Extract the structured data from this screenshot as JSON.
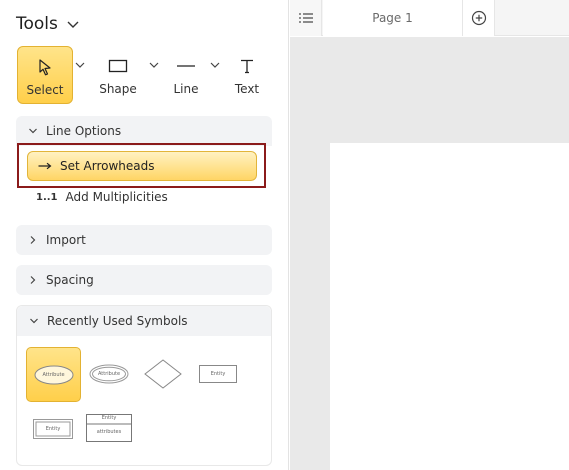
{
  "tools": {
    "title": "Tools",
    "items": [
      {
        "label": "Select",
        "icon": "cursor-icon",
        "active": true
      },
      {
        "label": "Shape",
        "icon": "rectangle-icon"
      },
      {
        "label": "Line",
        "icon": "line-icon"
      },
      {
        "label": "Text",
        "icon": "text-icon"
      }
    ]
  },
  "sections": {
    "line_options": {
      "title": "Line Options",
      "set_arrowheads": "Set Arrowheads",
      "add_multiplicities": "Add Multiplicities",
      "multiplicities_icon": "1..1"
    },
    "import": {
      "title": "Import"
    },
    "spacing": {
      "title": "Spacing"
    },
    "recent": {
      "title": "Recently Used Symbols",
      "symbols": [
        {
          "name": "attribute",
          "label": "Attribute"
        },
        {
          "name": "derived-attribute",
          "label": "Attribute"
        },
        {
          "name": "relationship",
          "label": ""
        },
        {
          "name": "entity",
          "label": "Entity"
        },
        {
          "name": "weak-entity",
          "label": "Entity"
        },
        {
          "name": "entity-with-attributes",
          "label": "Entity",
          "sublabel": "attributes"
        }
      ]
    }
  },
  "tabs": {
    "page_label": "Page 1"
  },
  "colors": {
    "accent": "#ffcf4a",
    "highlight_border": "#8b1b1b",
    "canvas": "#e9e9e9"
  }
}
